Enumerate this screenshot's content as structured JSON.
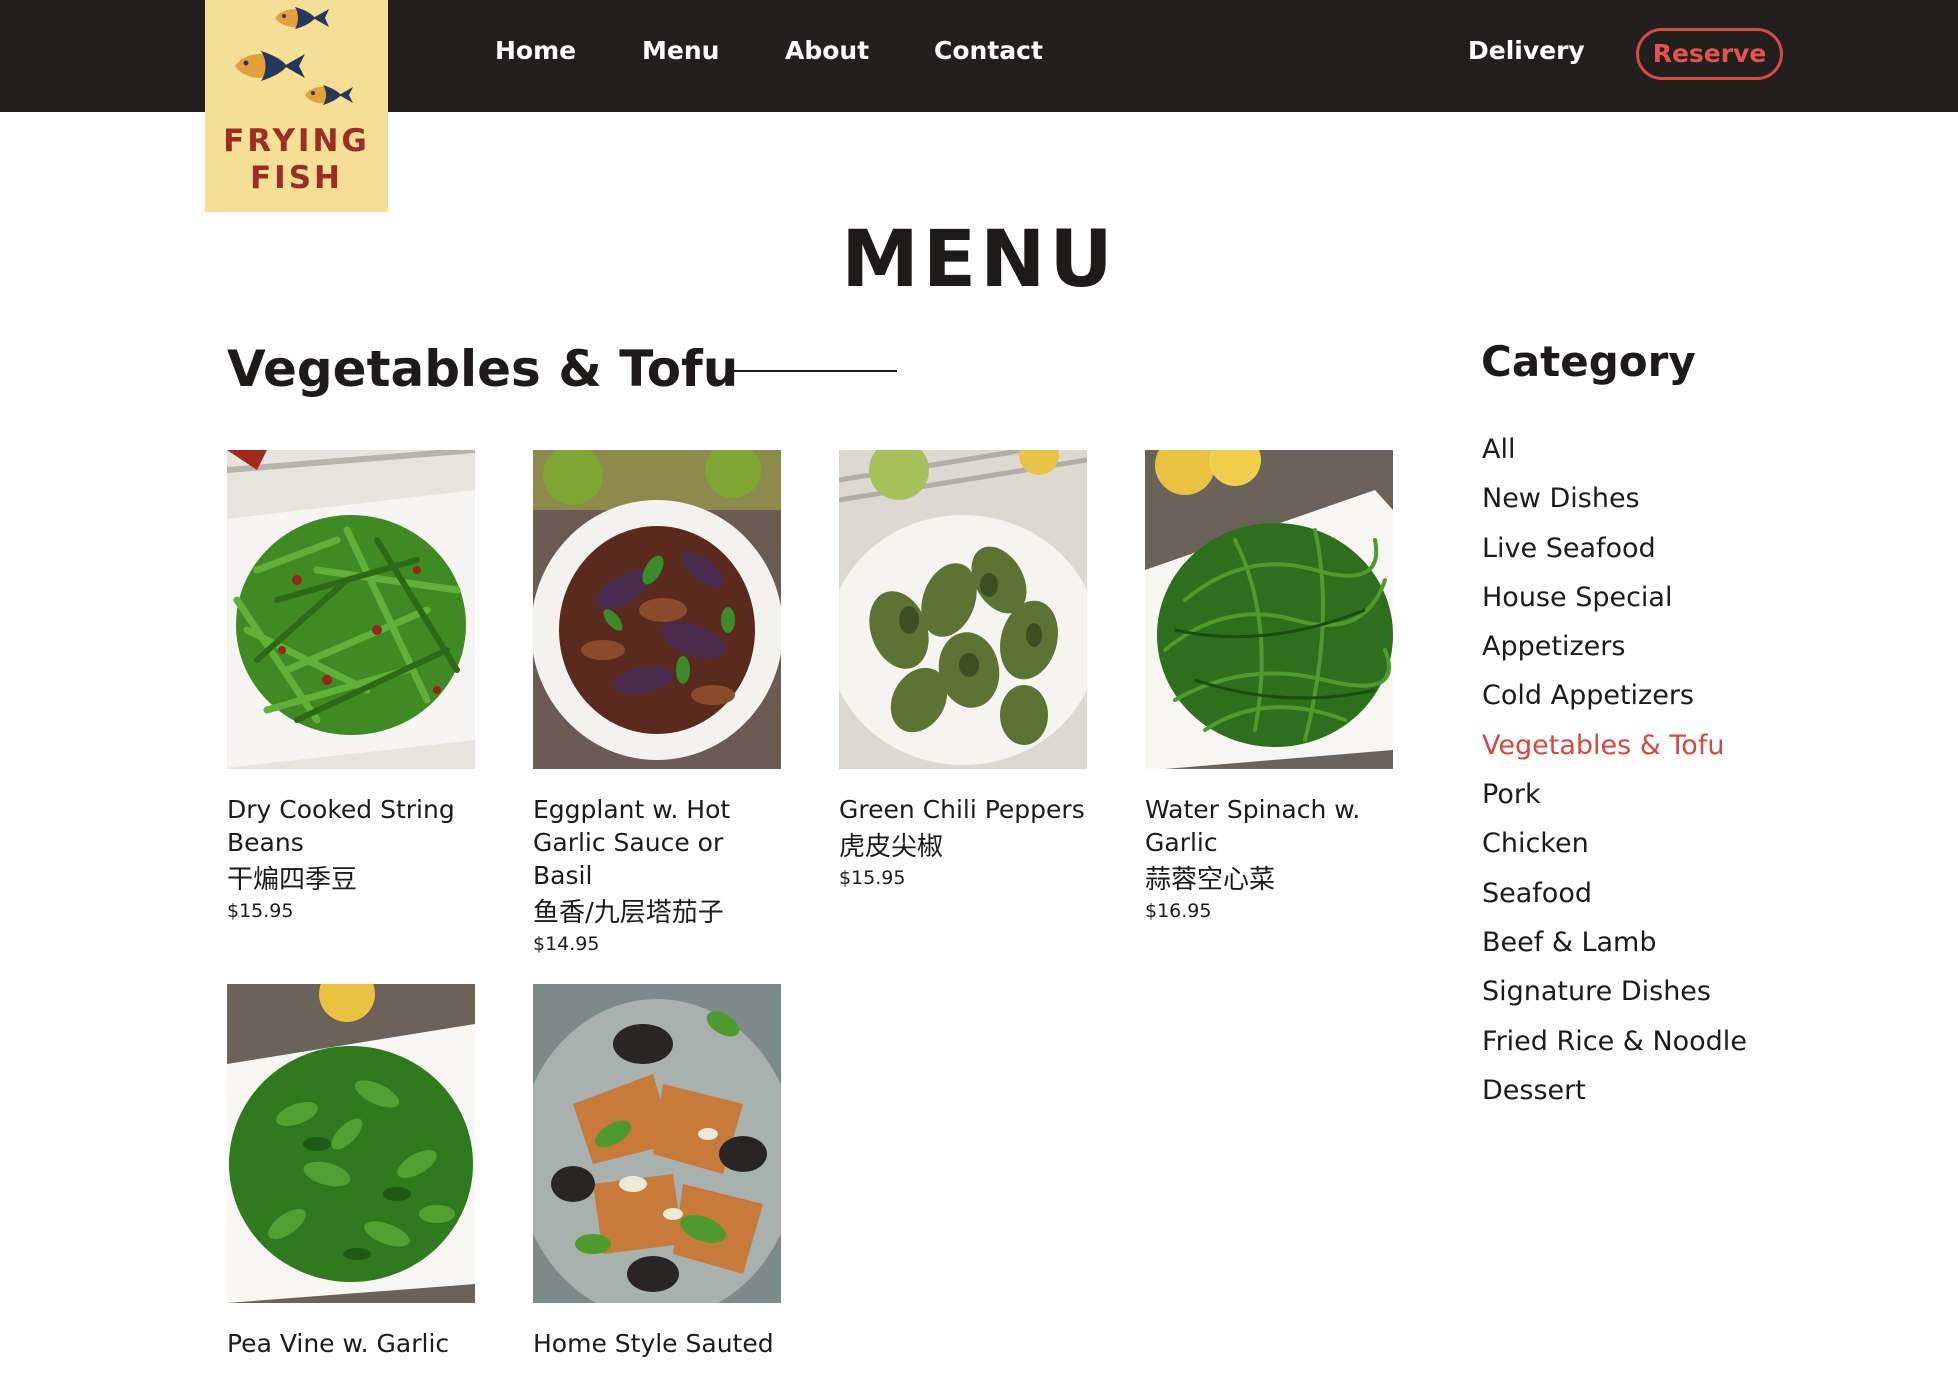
{
  "brand": {
    "line1": "FRYING",
    "line2": "FISH"
  },
  "nav": {
    "links": [
      "Home",
      "Menu",
      "About",
      "Contact"
    ],
    "delivery": "Delivery",
    "reserve": "Reserve"
  },
  "page_title": "MENU",
  "section": {
    "heading": "Vegetables & Tofu"
  },
  "dishes": [
    {
      "name": "Dry Cooked String Beans",
      "cn": "干煸四季豆",
      "price": "$15.95"
    },
    {
      "name": "Eggplant w. Hot Garlic Sauce or Basil",
      "cn": "鱼香/九层塔茄子",
      "price": "$14.95"
    },
    {
      "name": "Green Chili Peppers",
      "cn": "虎皮尖椒",
      "price": "$15.95"
    },
    {
      "name": "Water Spinach w. Garlic",
      "cn": "蒜蓉空心菜",
      "price": "$16.95"
    },
    {
      "name": "Pea Vine w. Garlic",
      "cn": "",
      "price": ""
    },
    {
      "name": "Home Style Sauted",
      "cn": "",
      "price": ""
    }
  ],
  "sidebar": {
    "title": "Category",
    "items": [
      "All",
      "New Dishes",
      "Live Seafood",
      "House Special",
      "Appetizers",
      "Cold Appetizers",
      "Vegetables & Tofu",
      "Pork",
      "Chicken",
      "Seafood",
      "Beef & Lamb",
      "Signature Dishes",
      "Fried Rice & Noodle",
      "Dessert"
    ],
    "active": "Vegetables & Tofu"
  },
  "colors": {
    "nav_bg": "#231f1e",
    "logo_bg": "#f5df96",
    "logo_text": "#9b2d24",
    "accent": "#d6473f",
    "text": "#1e1a19"
  }
}
